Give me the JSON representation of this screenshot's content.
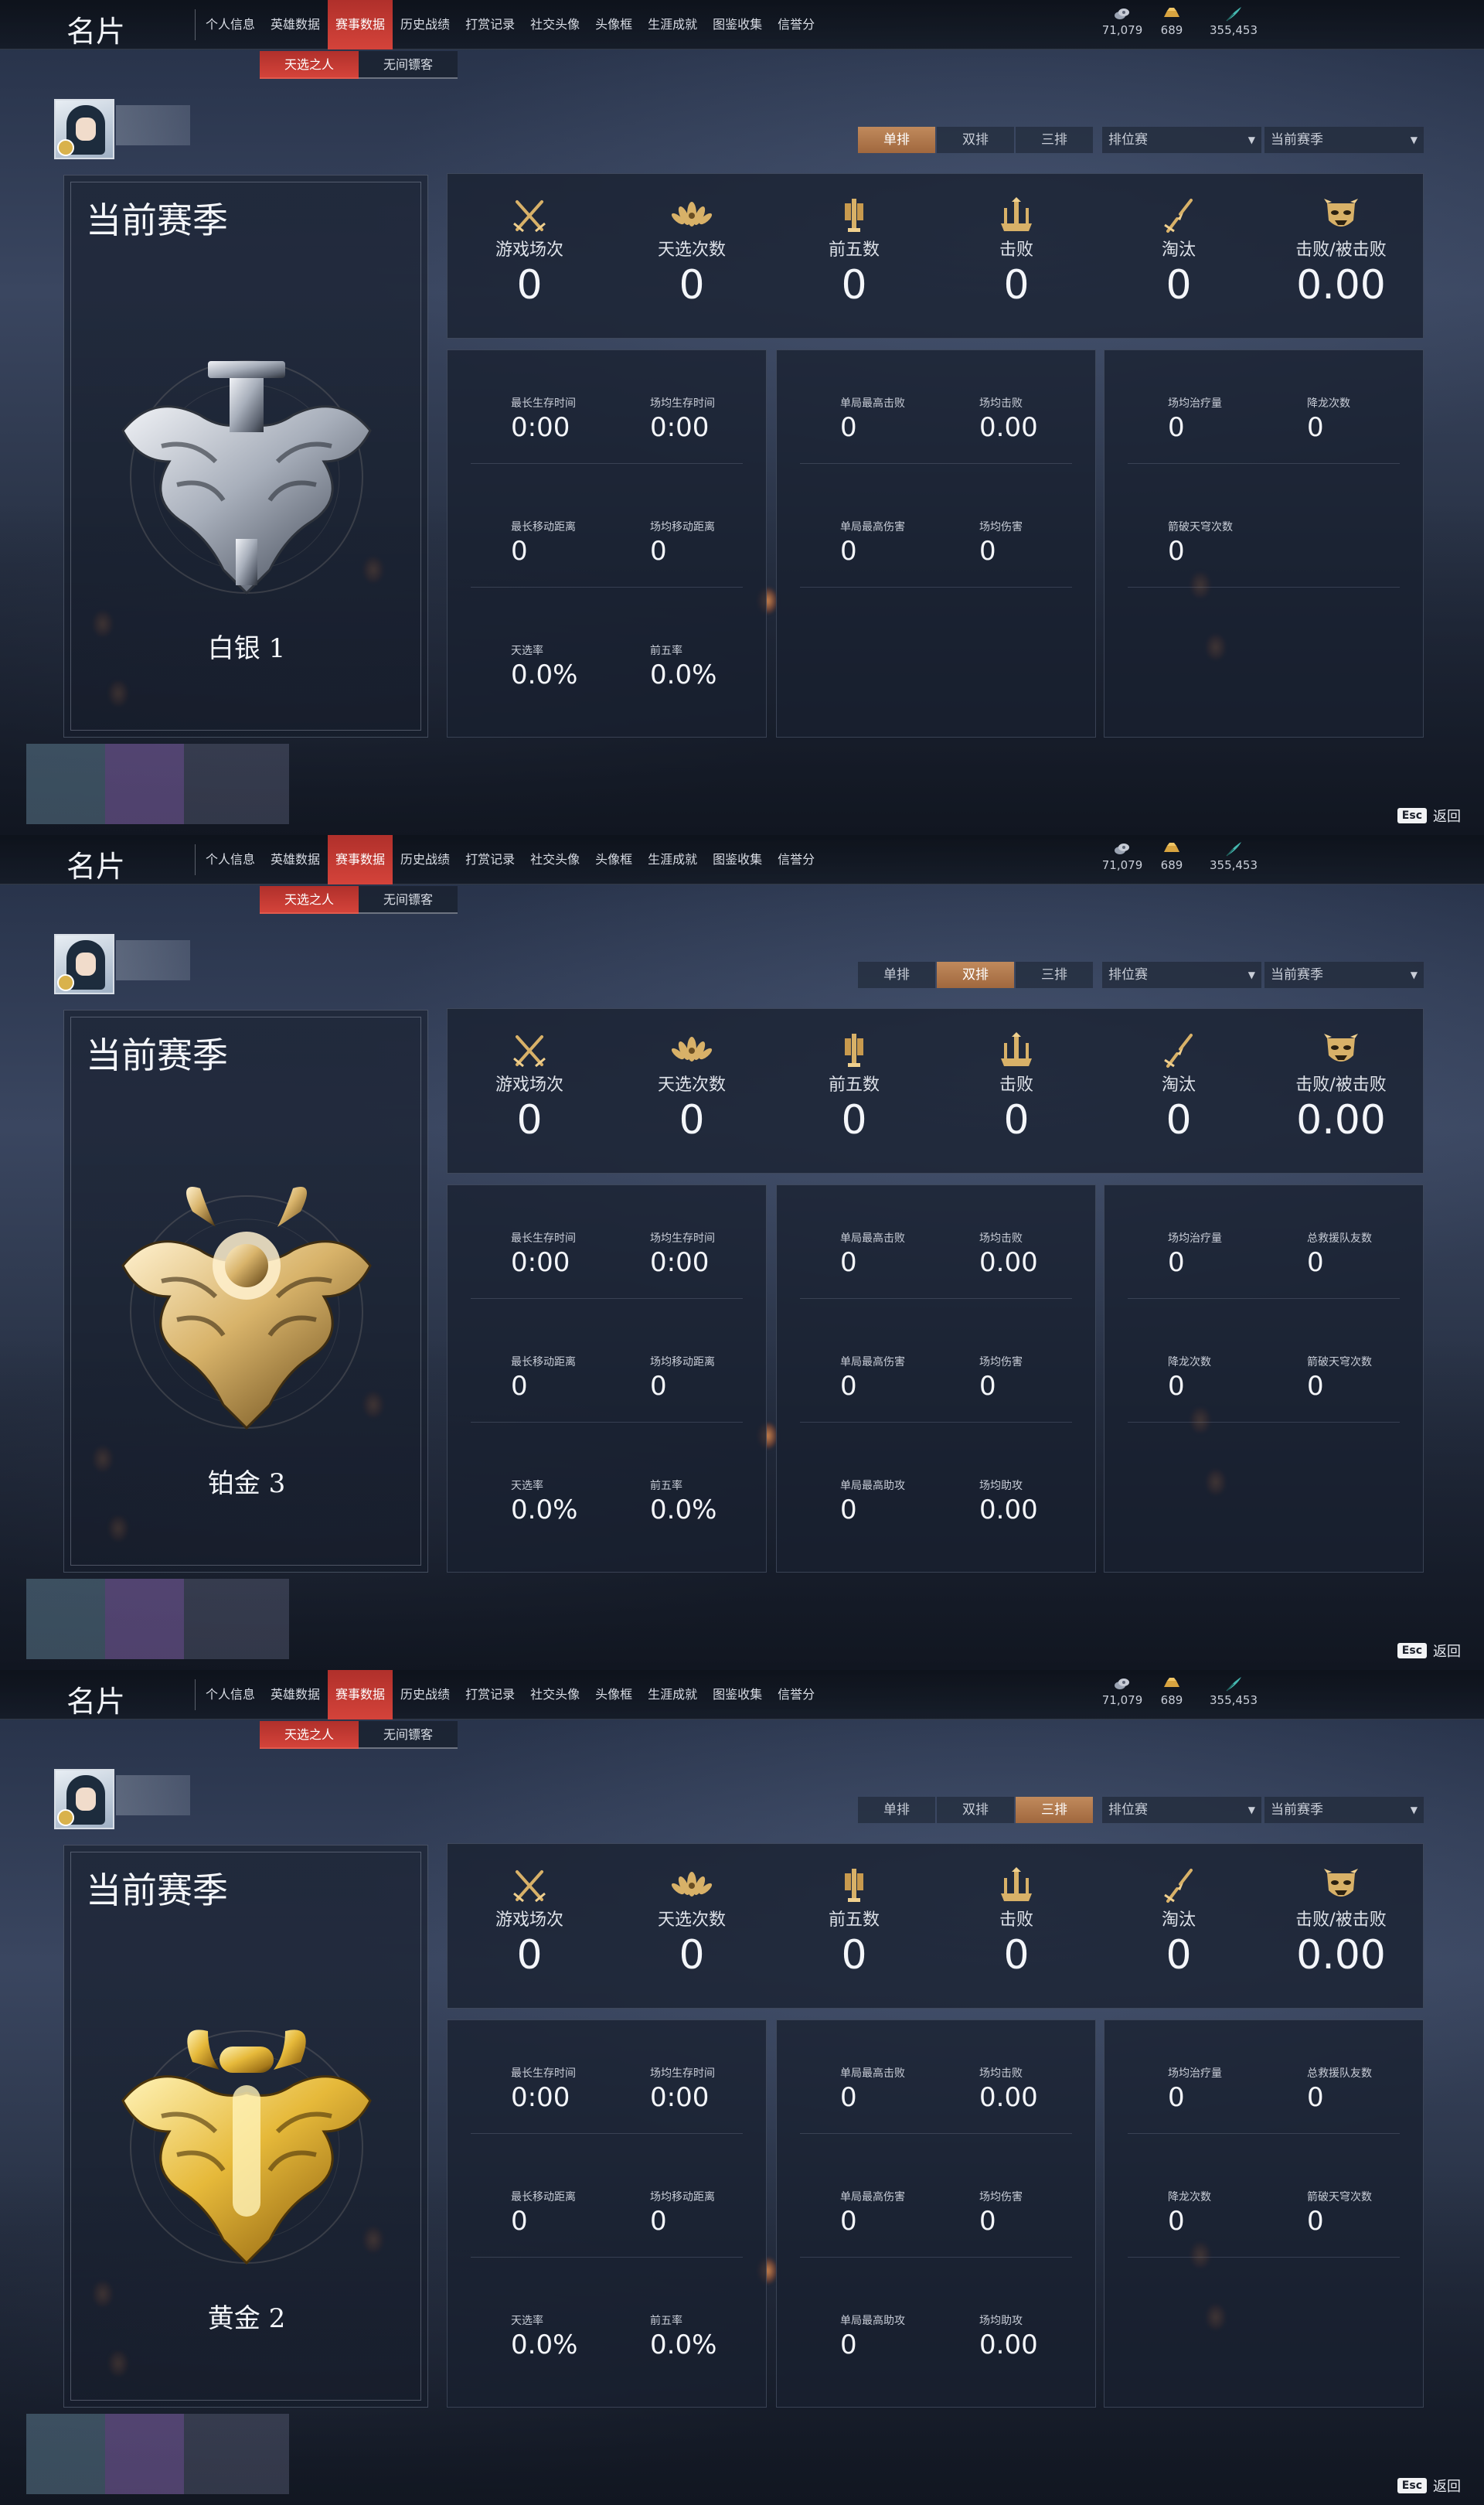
{
  "header": {
    "title": "名片",
    "nav_tabs": [
      "个人信息",
      "英雄数据",
      "赛事数据",
      "历史战绩",
      "打赏记录",
      "社交头像",
      "头像框",
      "生涯成就",
      "图鉴收集",
      "信誉分"
    ],
    "active_nav": 2,
    "currencies": [
      {
        "icon": "coin-stack-icon",
        "value": "71,079"
      },
      {
        "icon": "gold-ingot-icon",
        "value": "689"
      },
      {
        "icon": "feather-quill-icon",
        "value": "355,453"
      }
    ]
  },
  "subtabs": [
    "天选之人",
    "无间镖客"
  ],
  "active_subtab": 0,
  "mode_options": [
    "单排",
    "双排",
    "三排"
  ],
  "dropdowns": {
    "match_type": "排位赛",
    "season": "当前赛季"
  },
  "season_label": "当前赛季",
  "footer": {
    "esc_key": "Esc",
    "back": "返回"
  },
  "colors": {
    "accent_red": "#c83a33",
    "accent_bronze": "#b57a4c",
    "panel": "#1c2638"
  },
  "top_stats": [
    {
      "icon": "crossed-swords-icon",
      "label": "游戏场次",
      "value": "0"
    },
    {
      "icon": "lotus-emblem-icon",
      "label": "天选次数",
      "value": "0"
    },
    {
      "icon": "sword-banner-icon",
      "label": "前五数",
      "value": "0"
    },
    {
      "icon": "trident-crown-icon",
      "label": "击败",
      "value": "0"
    },
    {
      "icon": "broken-sword-icon",
      "label": "淘汰",
      "value": "0"
    },
    {
      "icon": "demon-mask-icon",
      "label": "击败/被击败",
      "value": "0.00"
    }
  ],
  "screens": [
    {
      "active_mode": 0,
      "rank": "白银 1",
      "rank_tier": "silver",
      "col1": [
        {
          "label": "最长生存时间",
          "value": "0:00"
        },
        {
          "label": "场均生存时间",
          "value": "0:00"
        },
        {
          "label": "最长移动距离",
          "value": "0"
        },
        {
          "label": "场均移动距离",
          "value": "0"
        },
        {
          "label": "天选率",
          "value": "0.0%"
        },
        {
          "label": "前五率",
          "value": "0.0%"
        }
      ],
      "col2": [
        {
          "label": "单局最高击败",
          "value": "0"
        },
        {
          "label": "场均击败",
          "value": "0.00"
        },
        {
          "label": "单局最高伤害",
          "value": "0"
        },
        {
          "label": "场均伤害",
          "value": "0"
        }
      ],
      "col3": [
        {
          "label": "场均治疗量",
          "value": "0"
        },
        {
          "label": "降龙次数",
          "value": "0"
        },
        {
          "label": "箭破天穹次数",
          "value": "0"
        }
      ]
    },
    {
      "active_mode": 1,
      "rank": "铂金 3",
      "rank_tier": "platinum",
      "col1": [
        {
          "label": "最长生存时间",
          "value": "0:00"
        },
        {
          "label": "场均生存时间",
          "value": "0:00"
        },
        {
          "label": "最长移动距离",
          "value": "0"
        },
        {
          "label": "场均移动距离",
          "value": "0"
        },
        {
          "label": "天选率",
          "value": "0.0%"
        },
        {
          "label": "前五率",
          "value": "0.0%"
        }
      ],
      "col2": [
        {
          "label": "单局最高击败",
          "value": "0"
        },
        {
          "label": "场均击败",
          "value": "0.00"
        },
        {
          "label": "单局最高伤害",
          "value": "0"
        },
        {
          "label": "场均伤害",
          "value": "0"
        },
        {
          "label": "单局最高助攻",
          "value": "0"
        },
        {
          "label": "场均助攻",
          "value": "0.00"
        }
      ],
      "col3": [
        {
          "label": "场均治疗量",
          "value": "0"
        },
        {
          "label": "总救援队友数",
          "value": "0"
        },
        {
          "label": "降龙次数",
          "value": "0"
        },
        {
          "label": "箭破天穹次数",
          "value": "0"
        }
      ]
    },
    {
      "active_mode": 2,
      "rank": "黄金 2",
      "rank_tier": "gold",
      "col1": [
        {
          "label": "最长生存时间",
          "value": "0:00"
        },
        {
          "label": "场均生存时间",
          "value": "0:00"
        },
        {
          "label": "最长移动距离",
          "value": "0"
        },
        {
          "label": "场均移动距离",
          "value": "0"
        },
        {
          "label": "天选率",
          "value": "0.0%"
        },
        {
          "label": "前五率",
          "value": "0.0%"
        }
      ],
      "col2": [
        {
          "label": "单局最高击败",
          "value": "0"
        },
        {
          "label": "场均击败",
          "value": "0.00"
        },
        {
          "label": "单局最高伤害",
          "value": "0"
        },
        {
          "label": "场均伤害",
          "value": "0"
        },
        {
          "label": "单局最高助攻",
          "value": "0"
        },
        {
          "label": "场均助攻",
          "value": "0.00"
        }
      ],
      "col3": [
        {
          "label": "场均治疗量",
          "value": "0"
        },
        {
          "label": "总救援队友数",
          "value": "0"
        },
        {
          "label": "降龙次数",
          "value": "0"
        },
        {
          "label": "箭破天穹次数",
          "value": "0"
        }
      ]
    }
  ]
}
